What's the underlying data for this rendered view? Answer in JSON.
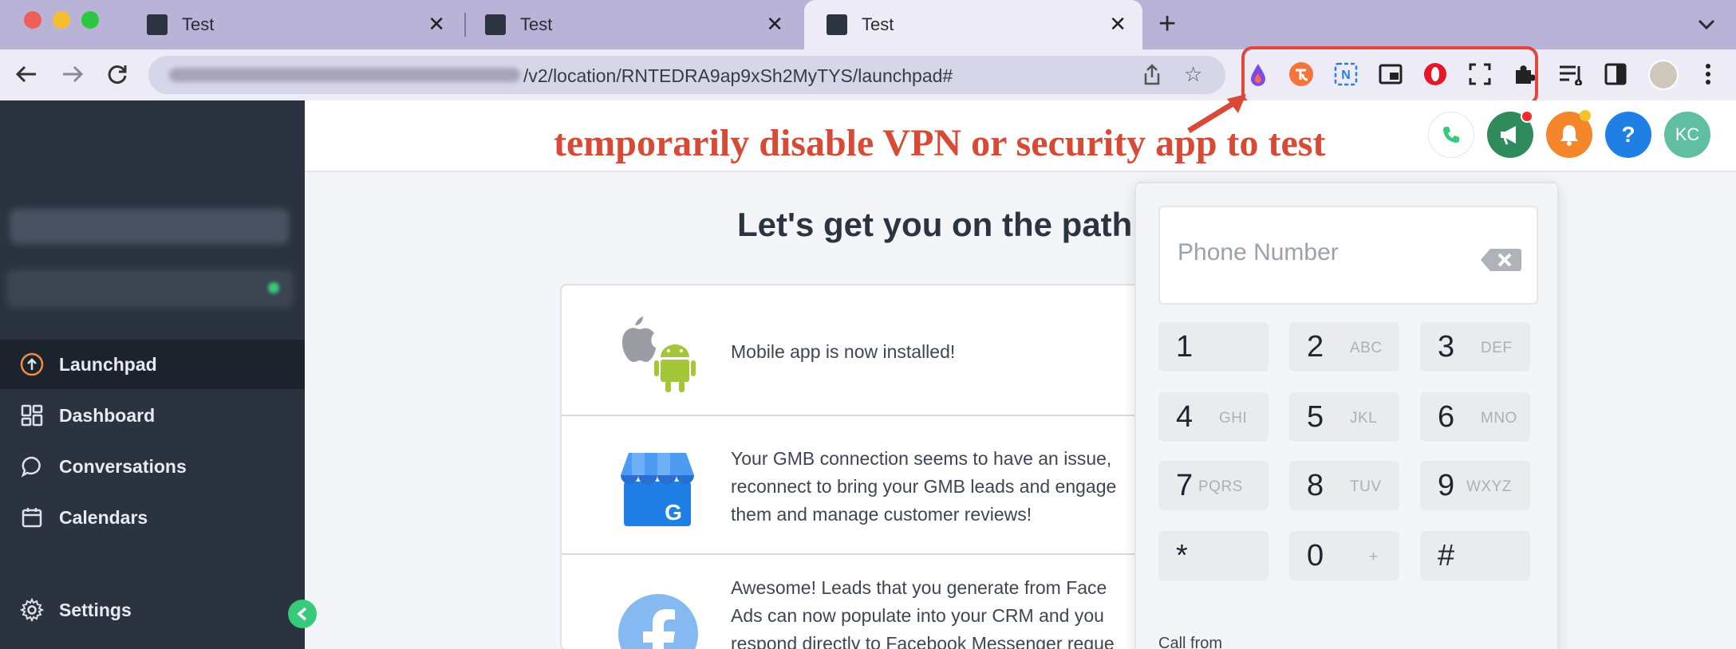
{
  "browser": {
    "tabs": [
      {
        "title": "Test",
        "active": false
      },
      {
        "title": "Test",
        "active": false
      },
      {
        "title": "Test",
        "active": true
      }
    ],
    "new_tab_label": "+",
    "url_visible": "/v2/location/RNTEDRA9ap9xSh2MyTYS/launchpad#",
    "extension_icons": [
      "drop-icon",
      "translate-icon",
      "n-icon",
      "picture-in-picture-icon",
      "opera-icon",
      "screenshot-icon",
      "puzzle-icon"
    ],
    "highlight_color": "#e2463a"
  },
  "annotation": {
    "text": "temporarily disable VPN or security app to test"
  },
  "header": {
    "avatar_initials": "KC",
    "help_label": "?",
    "buttons": [
      "phone-icon",
      "megaphone-icon",
      "bell-icon",
      "help-icon",
      "avatar"
    ]
  },
  "sidebar": {
    "items": [
      {
        "label": "Launchpad",
        "icon": "launchpad-icon",
        "active": true
      },
      {
        "label": "Dashboard",
        "icon": "dashboard-icon",
        "active": false
      },
      {
        "label": "Conversations",
        "icon": "chat-icon",
        "active": false
      },
      {
        "label": "Calendars",
        "icon": "calendar-icon",
        "active": false
      },
      {
        "label": "Settings",
        "icon": "gear-icon",
        "active": false
      }
    ],
    "collapse_icon": "chevron-left-icon"
  },
  "main": {
    "heading": "Let's get you on the path t",
    "cards": [
      {
        "text": "Mobile app is now installed!"
      },
      {
        "text_lines": [
          "Your GMB connection seems to have an issue,",
          "reconnect to bring your GMB leads and engage",
          "them and manage customer reviews!"
        ]
      },
      {
        "text_lines": [
          "Awesome! Leads that you generate from Face",
          "Ads can now populate into your CRM and you",
          "respond directly to Facebook Messenger reque"
        ]
      }
    ]
  },
  "dialer": {
    "placeholder": "Phone Number",
    "keys": [
      {
        "digit": "1",
        "letters": ""
      },
      {
        "digit": "2",
        "letters": "ABC"
      },
      {
        "digit": "3",
        "letters": "DEF"
      },
      {
        "digit": "4",
        "letters": "GHI"
      },
      {
        "digit": "5",
        "letters": "JKL"
      },
      {
        "digit": "6",
        "letters": "MNO"
      },
      {
        "digit": "7",
        "letters": "PQRS"
      },
      {
        "digit": "8",
        "letters": "TUV"
      },
      {
        "digit": "9",
        "letters": "WXYZ"
      },
      {
        "digit": "*",
        "letters": ""
      },
      {
        "digit": "0",
        "letters": "+"
      },
      {
        "digit": "#",
        "letters": ""
      }
    ],
    "call_from_label": "Call from"
  },
  "colors": {
    "sidebar_bg": "#2b3340",
    "accent_green": "#37ca7a",
    "annotation_red": "#d84a35"
  }
}
